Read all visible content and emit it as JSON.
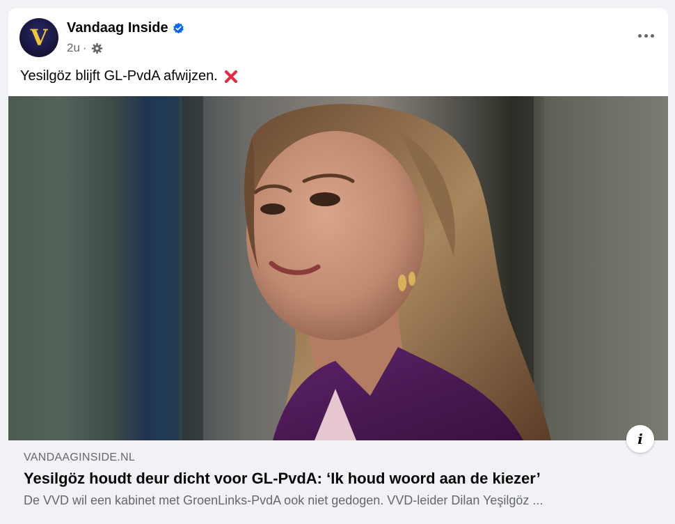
{
  "post": {
    "page_name": "Vandaag Inside",
    "avatar_letter": "V",
    "timestamp": "2u",
    "separator": "·",
    "text": "Yesilgöz blijft GL-PvdA afwijzen.",
    "emoji": "cross-mark-icon"
  },
  "icons": {
    "verified": "verified-badge-icon",
    "audience": "gear-icon",
    "more": "more-options-icon",
    "info": "info-icon"
  },
  "link": {
    "domain": "VANDAAGINSIDE.NL",
    "title": "Yesilgöz houdt deur dicht voor GL-PvdA: ‘Ik houd woord aan de kiezer’",
    "description": "De VVD wil een kabinet met GroenLinks-PvdA ook niet gedogen. VVD-leider Dilan Yeşilgöz ..."
  },
  "info_button_label": "i",
  "colors": {
    "accent": "#0866ff",
    "cross": "#dd2e44",
    "avatar_gold": "#f2c33c",
    "jacket_purple": "#4a1a55"
  }
}
